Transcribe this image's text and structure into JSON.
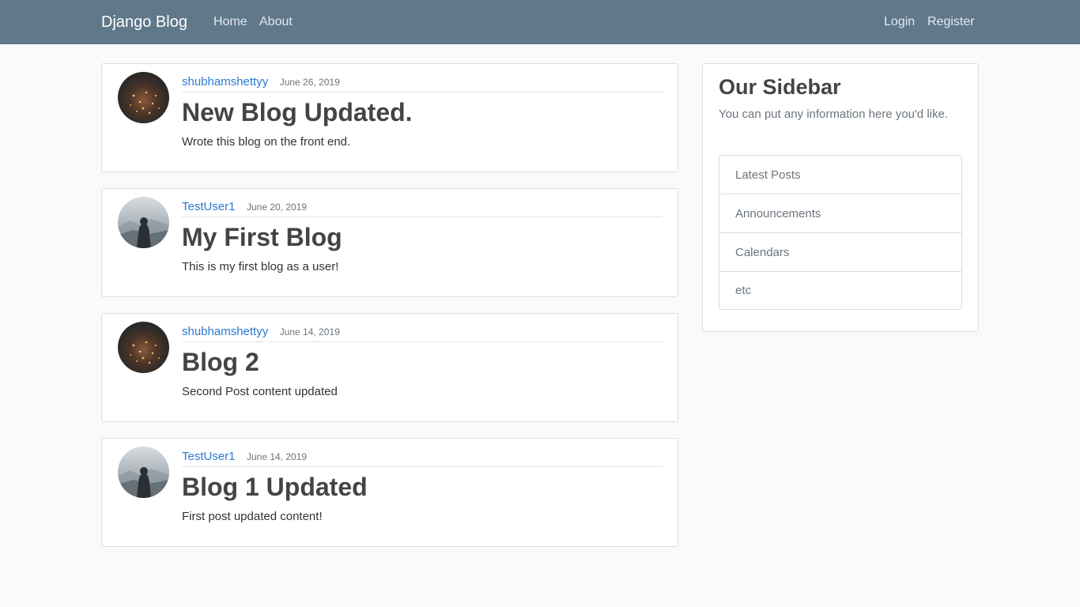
{
  "navbar": {
    "brand": "Django Blog",
    "left_links": [
      "Home",
      "About"
    ],
    "right_links": [
      "Login",
      "Register"
    ]
  },
  "posts": [
    {
      "author": "shubhamshettyy",
      "date": "June 26, 2019",
      "title": "New Blog Updated.",
      "content": "Wrote this blog on the front end.",
      "avatar": "city-lights-avatar"
    },
    {
      "author": "TestUser1",
      "date": "June 20, 2019",
      "title": "My First Blog",
      "content": "This is my first blog as a user!",
      "avatar": "hooded-figure-avatar"
    },
    {
      "author": "shubhamshettyy",
      "date": "June 14, 2019",
      "title": "Blog 2",
      "content": "Second Post content updated",
      "avatar": "city-lights-avatar"
    },
    {
      "author": "TestUser1",
      "date": "June 14, 2019",
      "title": "Blog 1 Updated",
      "content": "First post updated content!",
      "avatar": "hooded-figure-avatar"
    }
  ],
  "sidebar": {
    "title": "Our Sidebar",
    "description": "You can put any information here you'd like.",
    "items": [
      "Latest Posts",
      "Announcements",
      "Calendars",
      "etc"
    ]
  },
  "colors": {
    "navbar": "#5f788a",
    "link": "#2a7ad2",
    "background": "#fafafa"
  }
}
